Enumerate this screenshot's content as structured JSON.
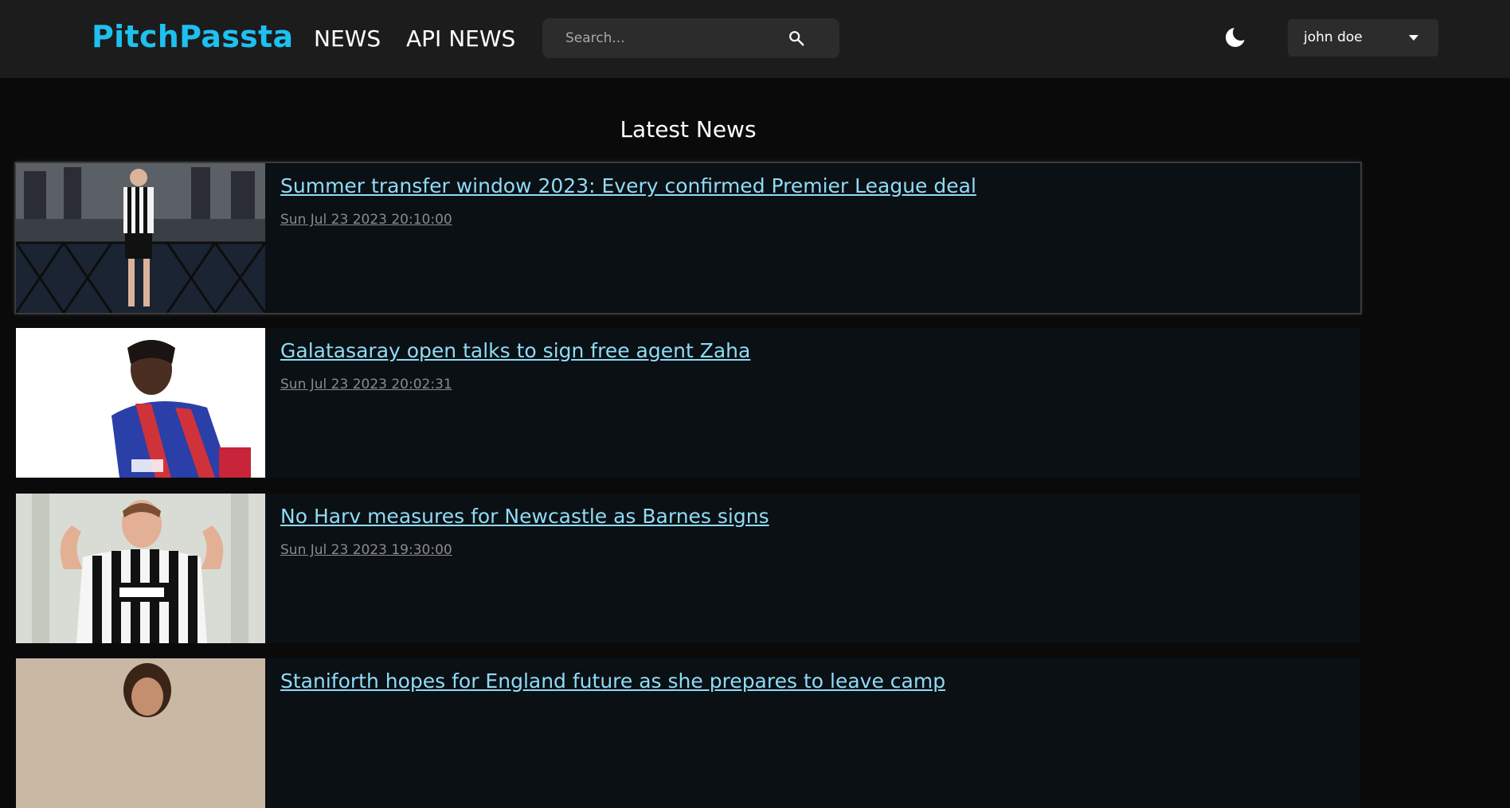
{
  "header": {
    "brand": "PitchPassta",
    "nav": {
      "news": "NEWS",
      "api_news": "API NEWS"
    },
    "search": {
      "placeholder": "Search...",
      "value": ""
    },
    "icons": {
      "search": "search-icon",
      "theme": "moon-icon",
      "dropdown": "caret-down-icon"
    },
    "user": {
      "name": "john doe"
    }
  },
  "main": {
    "title": "Latest News",
    "articles": [
      {
        "title": "Summer transfer window 2023: Every confirmed Premier League deal",
        "date": "Sun Jul 23 2023 20:10:00"
      },
      {
        "title": "Galatasaray open talks to sign free agent Zaha",
        "date": "Sun Jul 23 2023 20:02:31"
      },
      {
        "title": "No Harv measures for Newcastle as Barnes signs",
        "date": "Sun Jul 23 2023 19:30:00"
      },
      {
        "title": "Staniforth hopes for England future as she prepares to leave camp",
        "date": ""
      }
    ]
  },
  "colors": {
    "brand": "#1ec0f0",
    "header_bg": "#1c1c1c",
    "page_bg": "#0a0a0a",
    "card_bg": "#0b1015",
    "link": "#8fdcf5",
    "date": "#8a8a8a"
  }
}
